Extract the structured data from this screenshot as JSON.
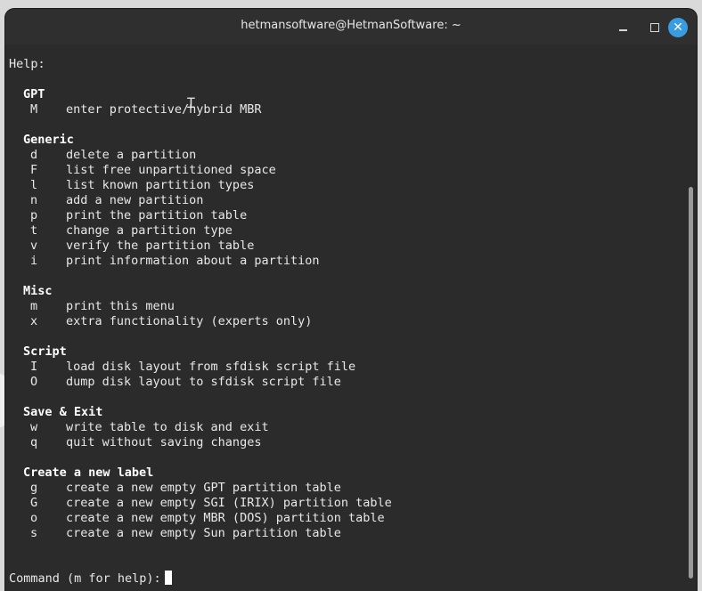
{
  "window": {
    "title": "hetmansoftware@HetmanSoftware: ~"
  },
  "terminal": {
    "help_header": "Help:",
    "sections": [
      {
        "title": "GPT",
        "commands": [
          {
            "key": "M",
            "desc": "enter protective/hybrid MBR"
          }
        ]
      },
      {
        "title": "Generic",
        "commands": [
          {
            "key": "d",
            "desc": "delete a partition"
          },
          {
            "key": "F",
            "desc": "list free unpartitioned space"
          },
          {
            "key": "l",
            "desc": "list known partition types"
          },
          {
            "key": "n",
            "desc": "add a new partition"
          },
          {
            "key": "p",
            "desc": "print the partition table"
          },
          {
            "key": "t",
            "desc": "change a partition type"
          },
          {
            "key": "v",
            "desc": "verify the partition table"
          },
          {
            "key": "i",
            "desc": "print information about a partition"
          }
        ]
      },
      {
        "title": "Misc",
        "commands": [
          {
            "key": "m",
            "desc": "print this menu"
          },
          {
            "key": "x",
            "desc": "extra functionality (experts only)"
          }
        ]
      },
      {
        "title": "Script",
        "commands": [
          {
            "key": "I",
            "desc": "load disk layout from sfdisk script file"
          },
          {
            "key": "O",
            "desc": "dump disk layout to sfdisk script file"
          }
        ]
      },
      {
        "title": "Save & Exit",
        "commands": [
          {
            "key": "w",
            "desc": "write table to disk and exit"
          },
          {
            "key": "q",
            "desc": "quit without saving changes"
          }
        ]
      },
      {
        "title": "Create a new label",
        "commands": [
          {
            "key": "g",
            "desc": "create a new empty GPT partition table"
          },
          {
            "key": "G",
            "desc": "create a new empty SGI (IRIX) partition table"
          },
          {
            "key": "o",
            "desc": "create a new empty MBR (DOS) partition table"
          },
          {
            "key": "s",
            "desc": "create a new empty Sun partition table"
          }
        ]
      }
    ],
    "prompt": "Command (m for help):"
  },
  "icons": {
    "minimize": "minimize-icon",
    "maximize": "maximize-icon",
    "close": "close-icon",
    "mouse": "text-cursor-icon"
  },
  "colors": {
    "terminal_bg": "#2b2b2b",
    "close_button": "#3a9ce0",
    "text": "#e8e8e8"
  }
}
